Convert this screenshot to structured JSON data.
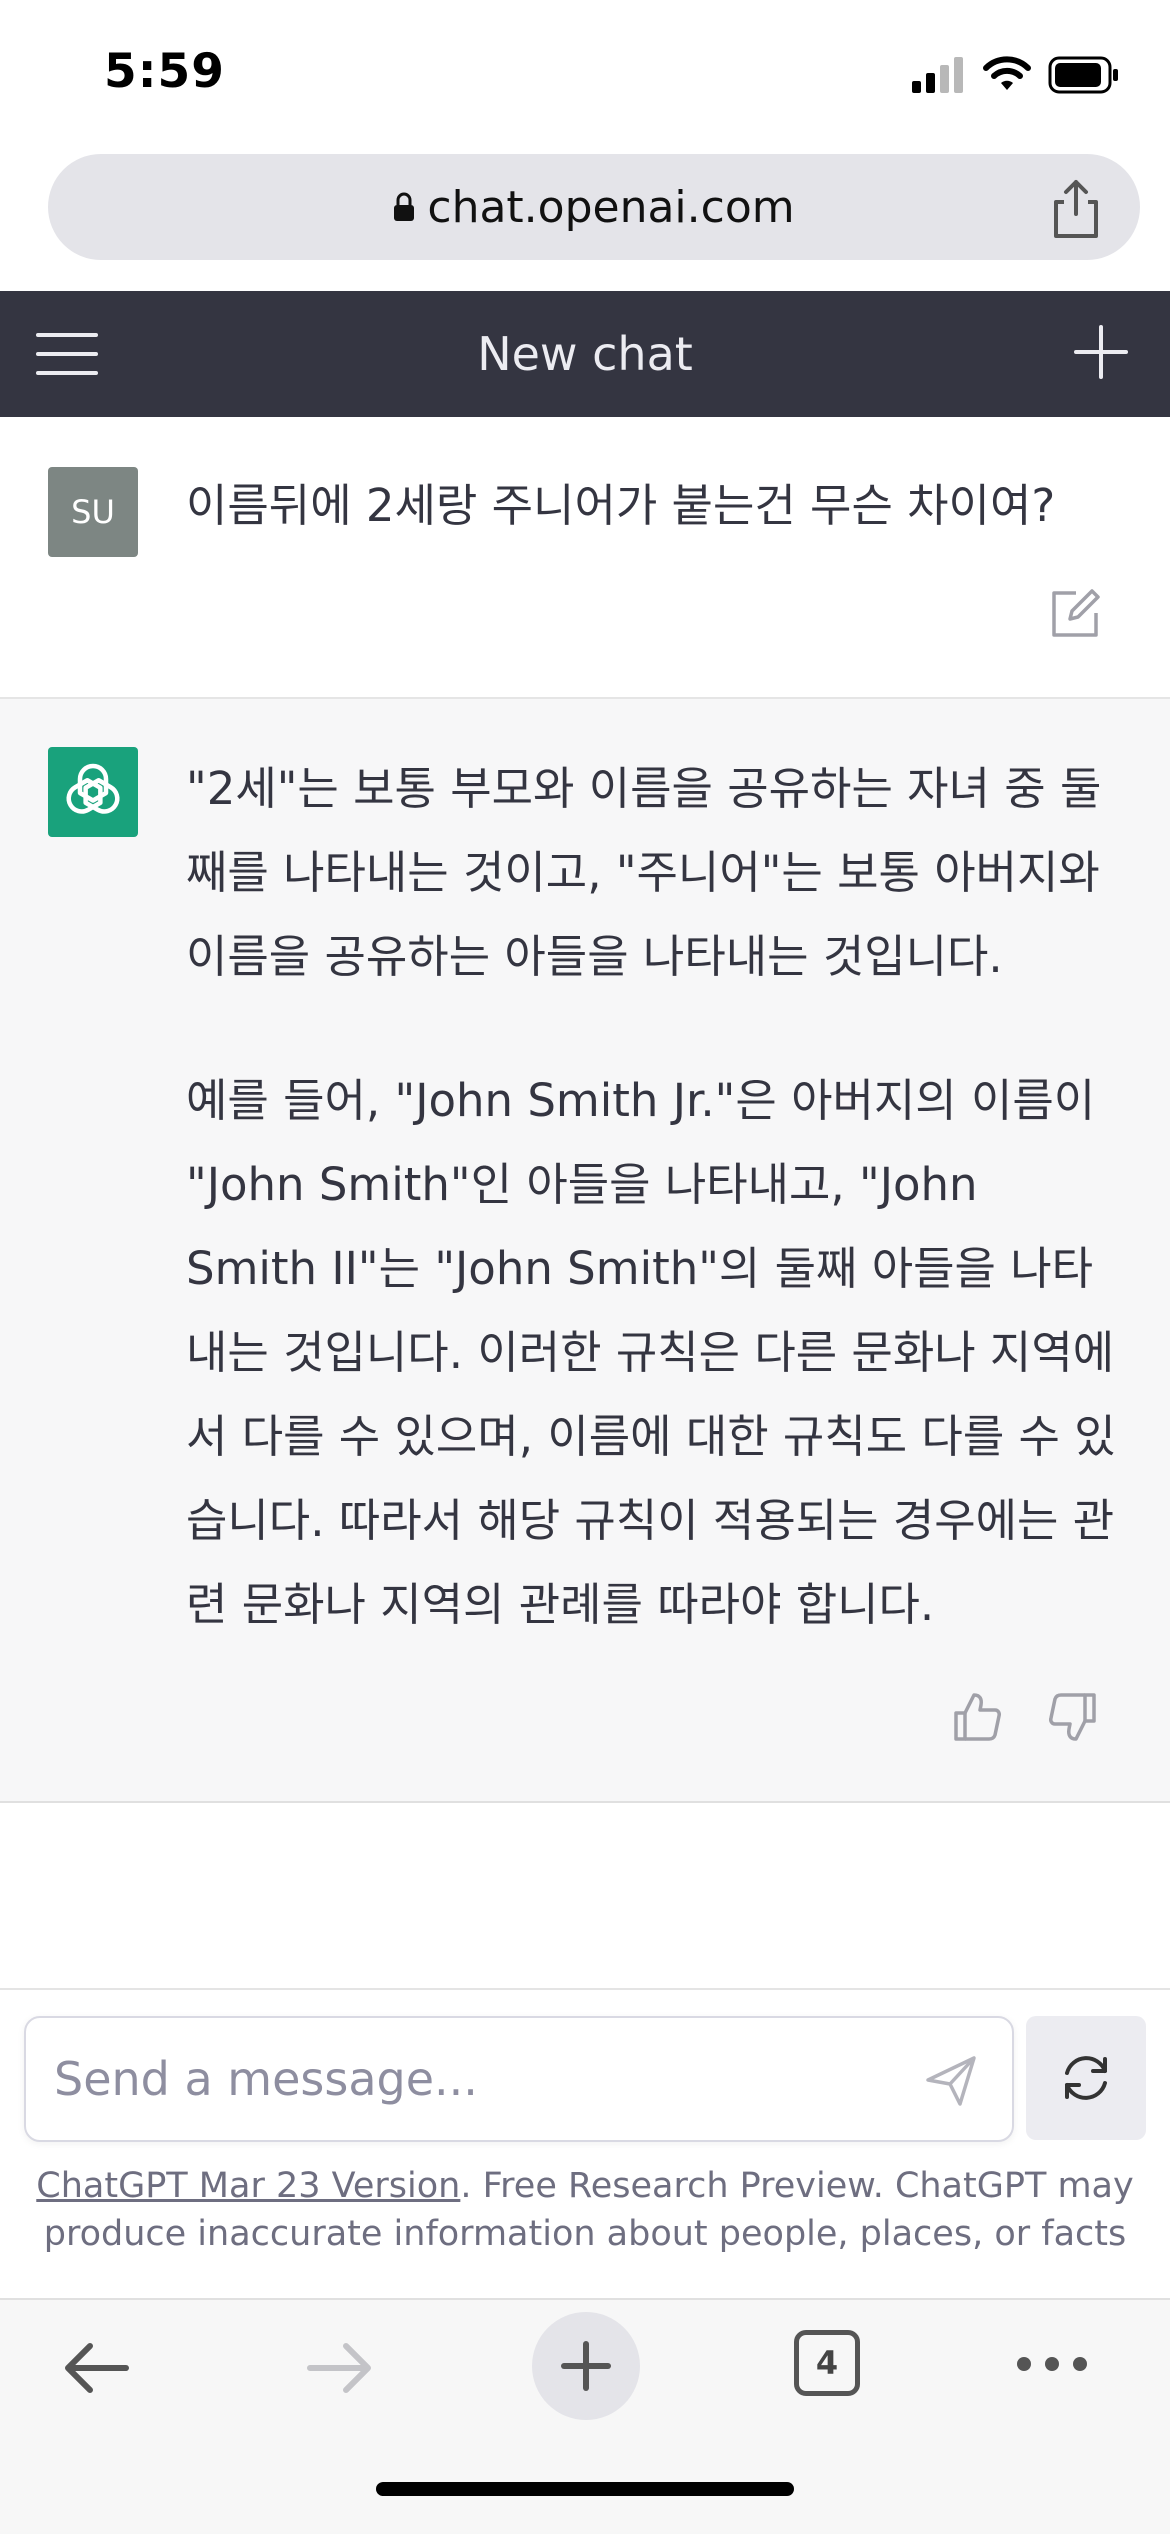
{
  "status_bar": {
    "time": "5:59"
  },
  "browser": {
    "url": "chat.openai.com",
    "tab_count": "4"
  },
  "header": {
    "title": "New chat"
  },
  "conversation": {
    "user": {
      "avatar_initials": "SU",
      "message": "이름뒤에 2세랑 주니어가 붙는건 무슨 차이여?"
    },
    "assistant": {
      "paragraphs": [
        "\"2세\"는 보통 부모와 이름을 공유하는 자녀 중 둘째를 나타내는 것이고, \"주니어\"는 보통 아버지와 이름을 공유하는 아들을 나타내는 것입니다.",
        "예를 들어, \"John Smith Jr.\"은 아버지의 이름이 \"John Smith\"인 아들을 나타내고, \"John Smith II\"는 \"John Smith\"의 둘째 아들을 나타내는 것입니다. 이러한 규칙은 다른 문화나 지역에서 다를 수 있으며, 이름에 대한 규칙도 다를 수 있습니다. 따라서 해당 규칙이 적용되는 경우에는 관련 문화나 지역의 관례를 따라야 합니다."
      ]
    }
  },
  "composer": {
    "placeholder": "Send a message...",
    "value": ""
  },
  "footer": {
    "version_link": "ChatGPT Mar 23 Version",
    "disclaimer": ". Free Research Preview. ChatGPT may produce inaccurate information about people, places, or facts"
  },
  "icons": {
    "header_left": "hamburger-menu-icon",
    "header_right": "plus-icon",
    "edit": "edit-icon",
    "feedback": [
      "thumbs-up-icon",
      "thumbs-down-icon"
    ],
    "send": "send-icon",
    "regenerate": "regenerate-icon",
    "toolbar": [
      "back-arrow-icon",
      "forward-arrow-icon",
      "new-tab-plus-icon",
      "tabs-icon",
      "more-icon"
    ]
  },
  "colors": {
    "header_bg": "#343541",
    "assistant_bg": "#f7f7f8",
    "assistant_avatar": "#19a27c",
    "user_avatar": "#7d8683"
  }
}
